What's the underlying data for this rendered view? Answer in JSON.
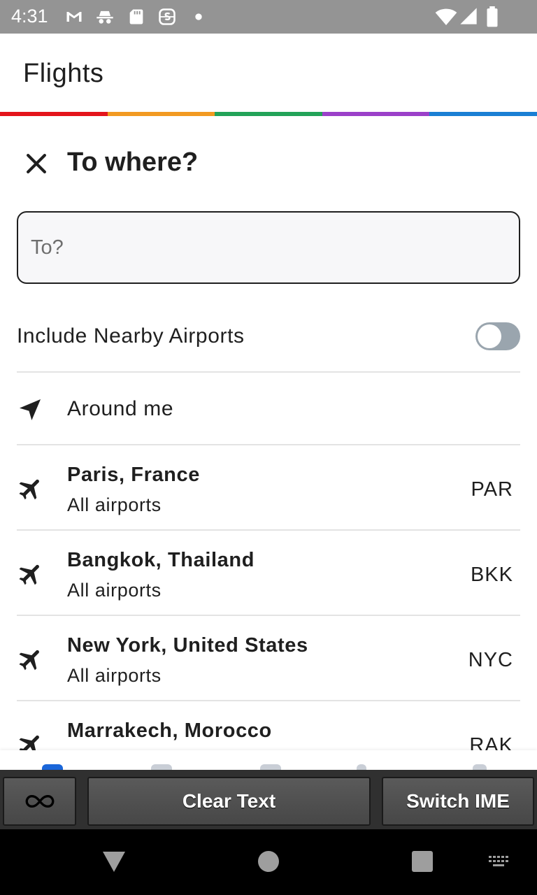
{
  "status_bar": {
    "time": "4:31",
    "icons": [
      "gmail-icon",
      "incognito-icon",
      "sd-card-icon",
      "s-app-icon",
      "dot-icon"
    ],
    "right_icons": [
      "wifi-icon",
      "signal-icon",
      "battery-icon"
    ]
  },
  "app_bar": {
    "title": "Flights",
    "rainbow_colors": [
      "#e4141b",
      "#f29a21",
      "#22a358",
      "#9b40c9",
      "#1a7fd4"
    ]
  },
  "header": {
    "close_icon": "close-icon",
    "title": "To where?"
  },
  "search": {
    "value": "",
    "placeholder": "To?"
  },
  "nearby": {
    "label": "Include Nearby Airports",
    "enabled": false
  },
  "around_me": {
    "icon": "navigation-arrow-icon",
    "label": "Around me"
  },
  "destinations": [
    {
      "city": "Paris, France",
      "subtitle": "All airports",
      "code": "PAR",
      "icon": "airplane-icon"
    },
    {
      "city": "Bangkok, Thailand",
      "subtitle": "All airports",
      "code": "BKK",
      "icon": "airplane-icon"
    },
    {
      "city": "New York, United States",
      "subtitle": "All airports",
      "code": "NYC",
      "icon": "airplane-icon"
    },
    {
      "city": "Marrakech, Morocco",
      "subtitle": "",
      "code": "RAK",
      "icon": "airplane-icon"
    }
  ],
  "ime_toolbar": {
    "infinity_icon": "infinity-icon",
    "clear_label": "Clear Text",
    "switch_label": "Switch IME"
  },
  "nav_bar": {
    "icons": [
      "back-icon",
      "home-icon",
      "recents-icon",
      "keyboard-icon"
    ]
  }
}
